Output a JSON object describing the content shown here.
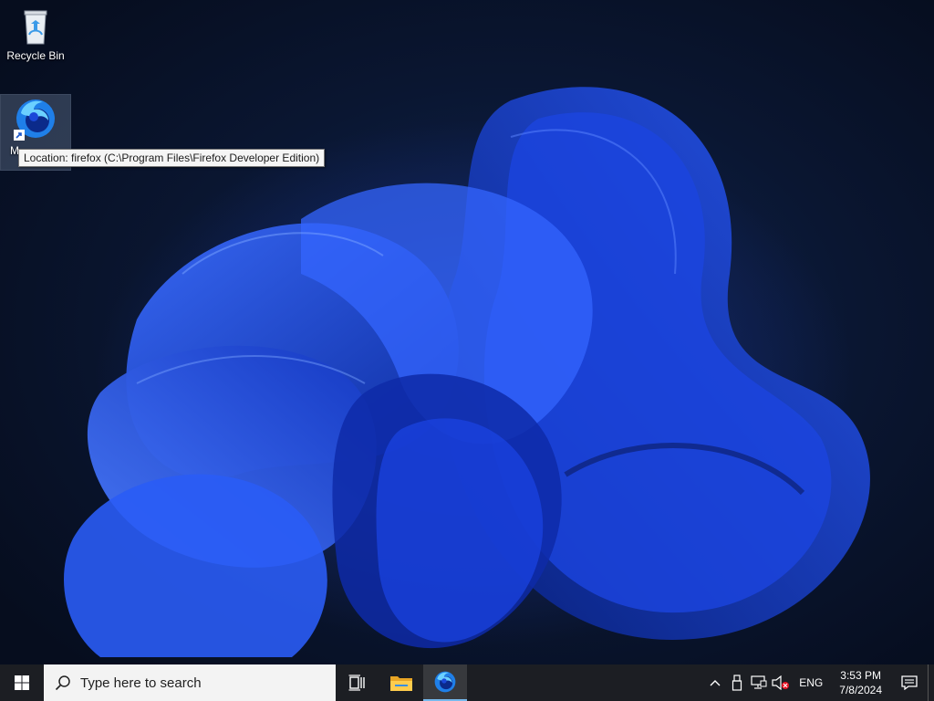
{
  "desktop": {
    "icons": [
      {
        "label": "Recycle Bin",
        "icon": "recycle-bin-icon"
      },
      {
        "label": "Mozilla Firefox",
        "label_visible": "M",
        "icon": "firefox-icon",
        "selected": true
      }
    ],
    "tooltip": "Location: firefox (C:\\Program Files\\Firefox Developer Edition)"
  },
  "taskbar": {
    "search_placeholder": "Type here to search",
    "pinned": [
      {
        "name": "task-view",
        "icon": "task-view-icon"
      },
      {
        "name": "file-explorer",
        "icon": "folder-icon"
      },
      {
        "name": "firefox",
        "icon": "firefox-icon",
        "active": true
      }
    ],
    "tray": {
      "language": "ENG",
      "time": "3:53 PM",
      "date": "7/8/2024",
      "icons": [
        "chevron-up-icon",
        "usb-icon",
        "network-icon",
        "volume-muted-icon",
        "notification-icon"
      ]
    }
  },
  "colors": {
    "taskbar_bg": "#1c1e23",
    "accent": "#76b9ed",
    "wallpaper_blue": "#1d4fd8"
  }
}
